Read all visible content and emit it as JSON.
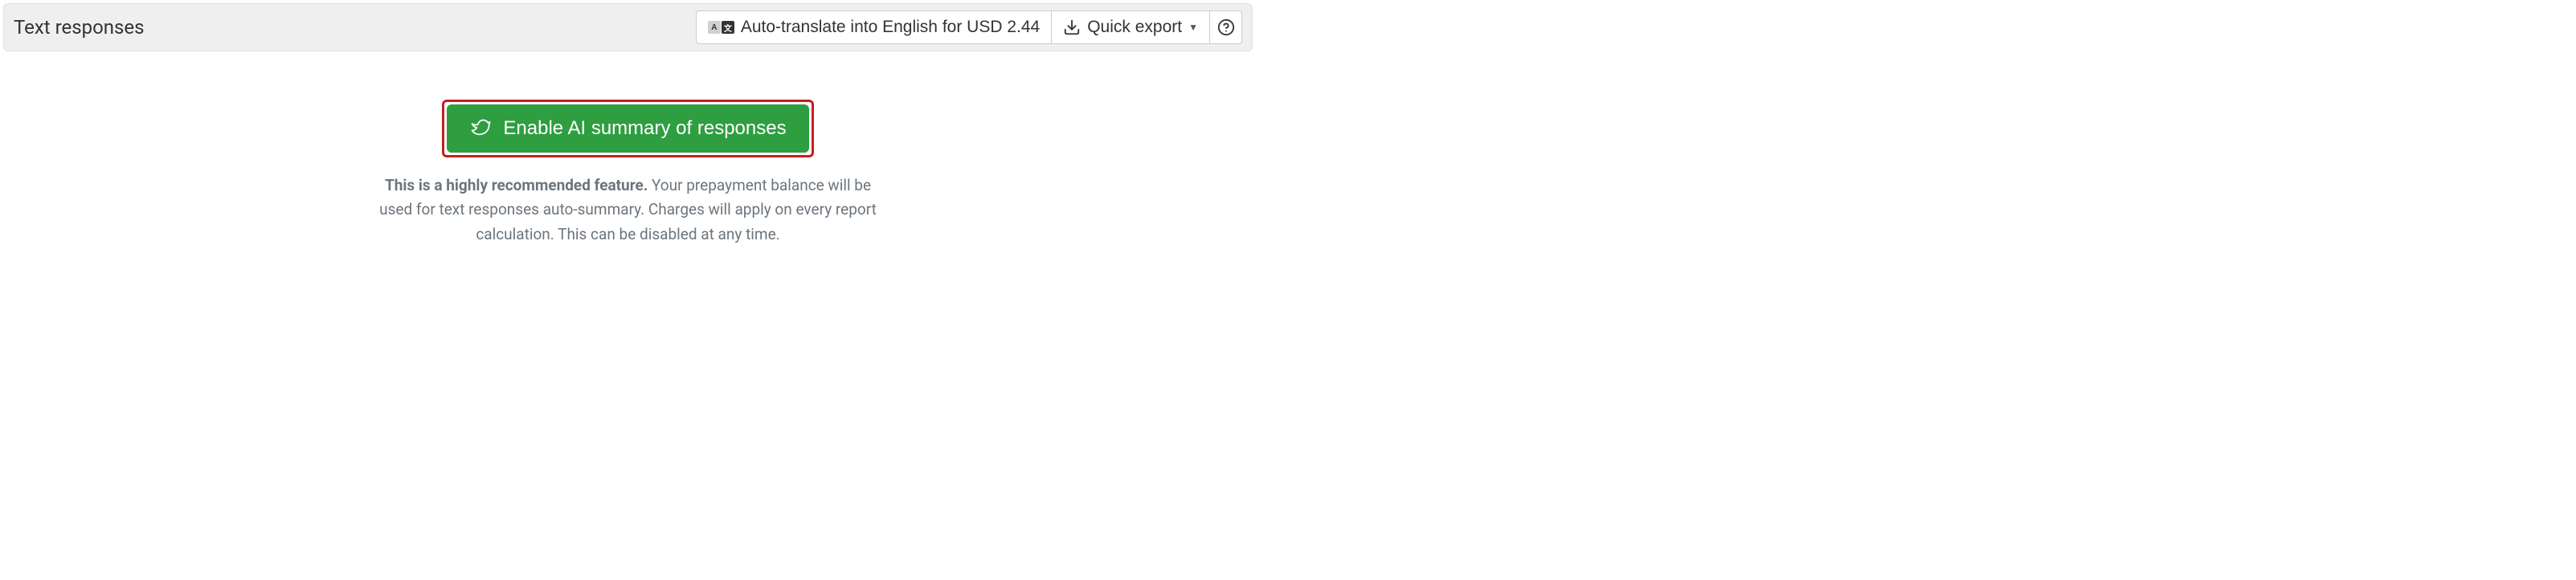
{
  "header": {
    "title": "Text responses",
    "translate_label": "Auto-translate into English for USD 2.44",
    "export_label": "Quick export",
    "help_label": "?"
  },
  "main": {
    "cta_label": "Enable AI summary of responses",
    "description_bold": "This is a highly recommended feature.",
    "description_rest": " Your prepayment balance will be used for text responses auto-summary. Charges will apply on every report calculation. This can be disabled at any time."
  }
}
